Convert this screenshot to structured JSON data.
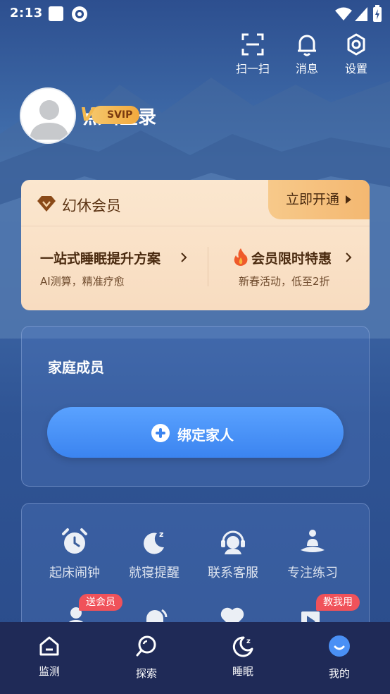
{
  "status_bar": {
    "time": "2:13"
  },
  "top_actions": [
    {
      "label": "扫一扫",
      "icon": "scan-icon"
    },
    {
      "label": "消息",
      "icon": "bell-icon"
    },
    {
      "label": "设置",
      "icon": "gear-icon"
    }
  ],
  "profile": {
    "login_text": "点击登录",
    "badge": "SVIP"
  },
  "vip_card": {
    "title": "幻休会员",
    "open_button": "立即开通",
    "features": [
      {
        "title": "一站式睡眠提升方案",
        "subtitle": "AI测算，精准疗愈"
      },
      {
        "title": "会员限时特惠",
        "subtitle": "新春活动，低至2折"
      }
    ]
  },
  "family": {
    "title": "家庭成员",
    "bind_button": "绑定家人"
  },
  "tools": [
    {
      "label": "起床闹钟",
      "icon": "alarm-clock-icon"
    },
    {
      "label": "就寝提醒",
      "icon": "moon-sleep-icon"
    },
    {
      "label": "联系客服",
      "icon": "customer-service-icon"
    },
    {
      "label": "专注练习",
      "icon": "meditation-icon"
    }
  ],
  "tool_tags": {
    "gift": "送会员",
    "tutorial": "教我用"
  },
  "tabbar": [
    {
      "label": "监测",
      "icon": "home-monitor-icon"
    },
    {
      "label": "探索",
      "icon": "explore-icon"
    },
    {
      "label": "睡眠",
      "icon": "sleep-moon-icon"
    },
    {
      "label": "我的",
      "icon": "profile-face-icon",
      "active": true
    }
  ],
  "colors": {
    "accent_blue": "#3b84f0",
    "vip_gold": "#f4b871",
    "tag_red": "#f0525a",
    "tabbar_bg": "#1f2a57"
  }
}
